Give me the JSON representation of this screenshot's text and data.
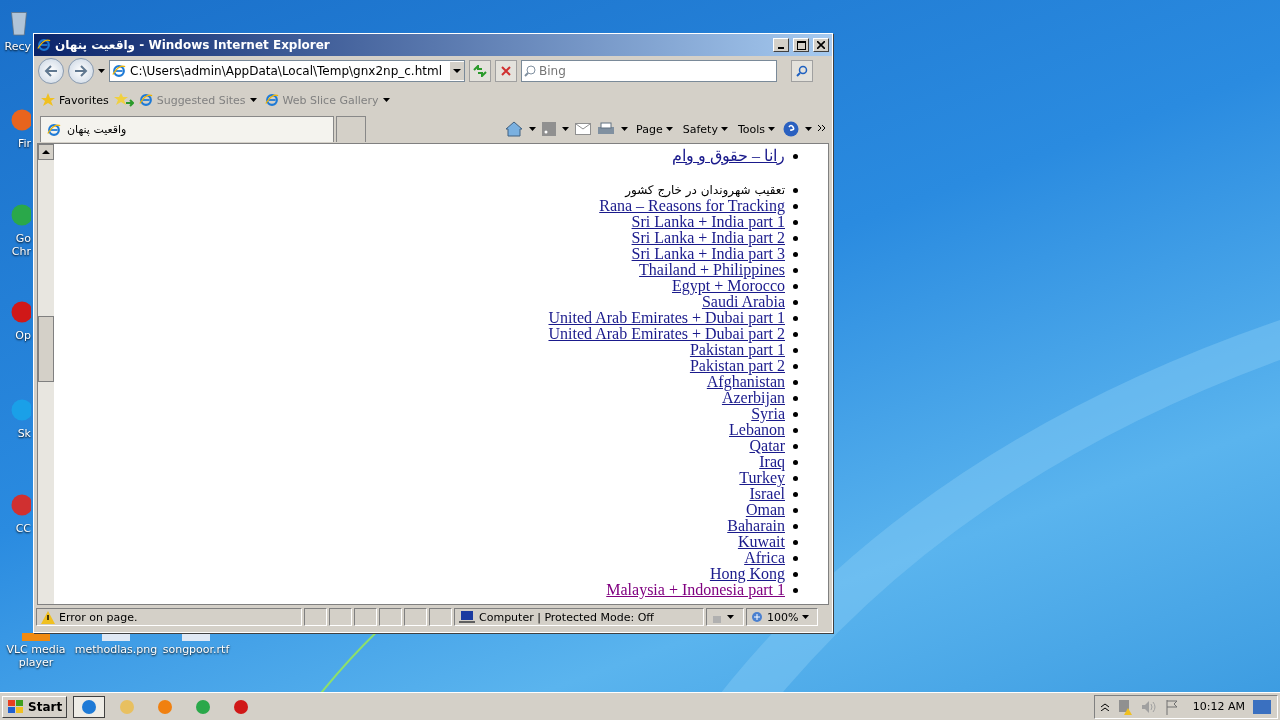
{
  "desktop_icons": [
    {
      "label": "Recy",
      "kind": "bin"
    },
    {
      "label": "Fir",
      "kind": "browser"
    },
    {
      "label": "Go Chr",
      "kind": "chrome"
    },
    {
      "label": "Op",
      "kind": "opera"
    },
    {
      "label": "Sk",
      "kind": "skype"
    },
    {
      "label": "CC",
      "kind": "cleaner"
    }
  ],
  "desktop_files": [
    {
      "label": "VLC media player"
    },
    {
      "label": "methodlas.png"
    },
    {
      "label": "songpoor.rtf"
    }
  ],
  "window": {
    "title": "واقعیت پنهان - Windows Internet Explorer"
  },
  "address": {
    "value": "C:\\Users\\admin\\AppData\\Local\\Temp\\gnx2np_c.html"
  },
  "search": {
    "placeholder": "Bing"
  },
  "favorites_bar": {
    "favorites": "Favorites",
    "links": [
      "Suggested Sites",
      "Web Slice Gallery"
    ]
  },
  "tab": {
    "title": "واقعیت پنهان",
    "selected": true
  },
  "command_bar": [
    "Page",
    "Safety",
    "Tools"
  ],
  "page": {
    "sections": [
      {
        "items": [
          {
            "kind": "link",
            "text": "رانا – حقوق و وام",
            "visited": false
          }
        ]
      },
      {
        "items": [
          {
            "kind": "text",
            "text": "تعقیب شهروندان در خارج کشور"
          },
          {
            "kind": "link",
            "text": "Rana – Reasons for Tracking",
            "visited": false
          },
          {
            "kind": "link",
            "text": "Sri Lanka + India part 1",
            "visited": false
          },
          {
            "kind": "link",
            "text": "Sri Lanka + India part 2",
            "visited": false
          },
          {
            "kind": "link",
            "text": "Sri Lanka + India part 3",
            "visited": false
          },
          {
            "kind": "link",
            "text": "Thailand + Philippines",
            "visited": false
          },
          {
            "kind": "link",
            "text": "Egypt + Morocco",
            "visited": false
          },
          {
            "kind": "link",
            "text": "Saudi Arabia",
            "visited": false
          },
          {
            "kind": "link",
            "text": "United Arab Emirates + Dubai part 1",
            "visited": false
          },
          {
            "kind": "link",
            "text": "United Arab Emirates + Dubai part 2",
            "visited": false
          },
          {
            "kind": "link",
            "text": "Pakistan part 1",
            "visited": false
          },
          {
            "kind": "link",
            "text": "Pakistan part 2",
            "visited": false
          },
          {
            "kind": "link",
            "text": "Afghanistan",
            "visited": false
          },
          {
            "kind": "link",
            "text": "Azerbijan",
            "visited": false
          },
          {
            "kind": "link",
            "text": "Syria",
            "visited": false
          },
          {
            "kind": "link",
            "text": "Lebanon",
            "visited": false
          },
          {
            "kind": "link",
            "text": "Qatar",
            "visited": false
          },
          {
            "kind": "link",
            "text": "Iraq",
            "visited": false
          },
          {
            "kind": "link",
            "text": "Turkey",
            "visited": false
          },
          {
            "kind": "link",
            "text": "Israel",
            "visited": false
          },
          {
            "kind": "link",
            "text": "Oman",
            "visited": false
          },
          {
            "kind": "link",
            "text": "Baharain",
            "visited": false
          },
          {
            "kind": "link",
            "text": "Kuwait",
            "visited": false
          },
          {
            "kind": "link",
            "text": "Africa",
            "visited": false
          },
          {
            "kind": "link",
            "text": "Hong Kong",
            "visited": false
          },
          {
            "kind": "link",
            "text": "Malaysia + Indonesia part 1",
            "visited": true
          }
        ]
      }
    ]
  },
  "status_bar": {
    "message": "Error on page.",
    "zone": "Computer | Protected Mode: Off",
    "zoom": "100%"
  },
  "taskbar": {
    "start": "Start",
    "apps": [
      {
        "kind": "ie",
        "selected": true
      },
      {
        "kind": "folder",
        "selected": false
      },
      {
        "kind": "media",
        "selected": false
      },
      {
        "kind": "chrome",
        "selected": false
      },
      {
        "kind": "opera",
        "selected": false
      }
    ],
    "clock": "10:12 AM"
  }
}
